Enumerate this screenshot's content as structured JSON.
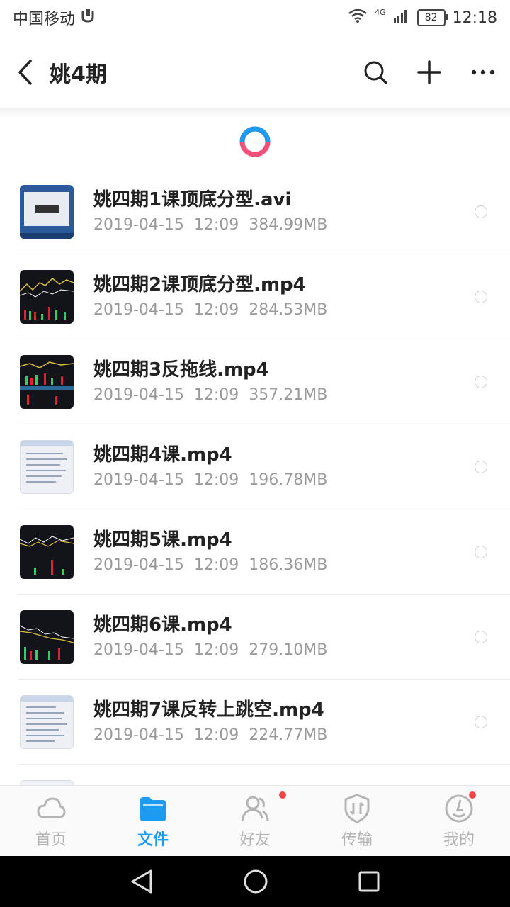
{
  "status": {
    "carrier": "中国移动",
    "network": "4G",
    "battery": "82",
    "time": "12:18"
  },
  "header": {
    "title": "姚4期"
  },
  "files": [
    {
      "name": "姚四期1课顶底分型.avi",
      "date": "2019-04-15",
      "time": "12:09",
      "size": "384.99MB",
      "thumb": "desktop"
    },
    {
      "name": "姚四期2课顶底分型.mp4",
      "date": "2019-04-15",
      "time": "12:09",
      "size": "284.53MB",
      "thumb": "chart"
    },
    {
      "name": "姚四期3反拖线.mp4",
      "date": "2019-04-15",
      "time": "12:09",
      "size": "357.21MB",
      "thumb": "chart"
    },
    {
      "name": "姚四期4课.mp4",
      "date": "2019-04-15",
      "time": "12:09",
      "size": "196.78MB",
      "thumb": "document"
    },
    {
      "name": "姚四期5课.mp4",
      "date": "2019-04-15",
      "time": "12:09",
      "size": "186.36MB",
      "thumb": "chart"
    },
    {
      "name": "姚四期6课.mp4",
      "date": "2019-04-15",
      "time": "12:09",
      "size": "279.10MB",
      "thumb": "chart"
    },
    {
      "name": "姚四期7课反转上跳空.mp4",
      "date": "2019-04-15",
      "time": "12:09",
      "size": "224.77MB",
      "thumb": "document"
    }
  ],
  "nav": {
    "items": [
      {
        "label": "首页",
        "icon": "cloud-icon",
        "active": false,
        "badge": false
      },
      {
        "label": "文件",
        "icon": "folder-icon",
        "active": true,
        "badge": false
      },
      {
        "label": "好友",
        "icon": "friends-icon",
        "active": false,
        "badge": true
      },
      {
        "label": "传输",
        "icon": "transfer-icon",
        "active": false,
        "badge": false
      },
      {
        "label": "我的",
        "icon": "profile-icon",
        "active": false,
        "badge": true
      }
    ]
  },
  "colors": {
    "accent": "#1c9bf0",
    "badge": "#f04848",
    "spinner_blue": "#1c9bf0",
    "spinner_pink": "#f0507a"
  }
}
